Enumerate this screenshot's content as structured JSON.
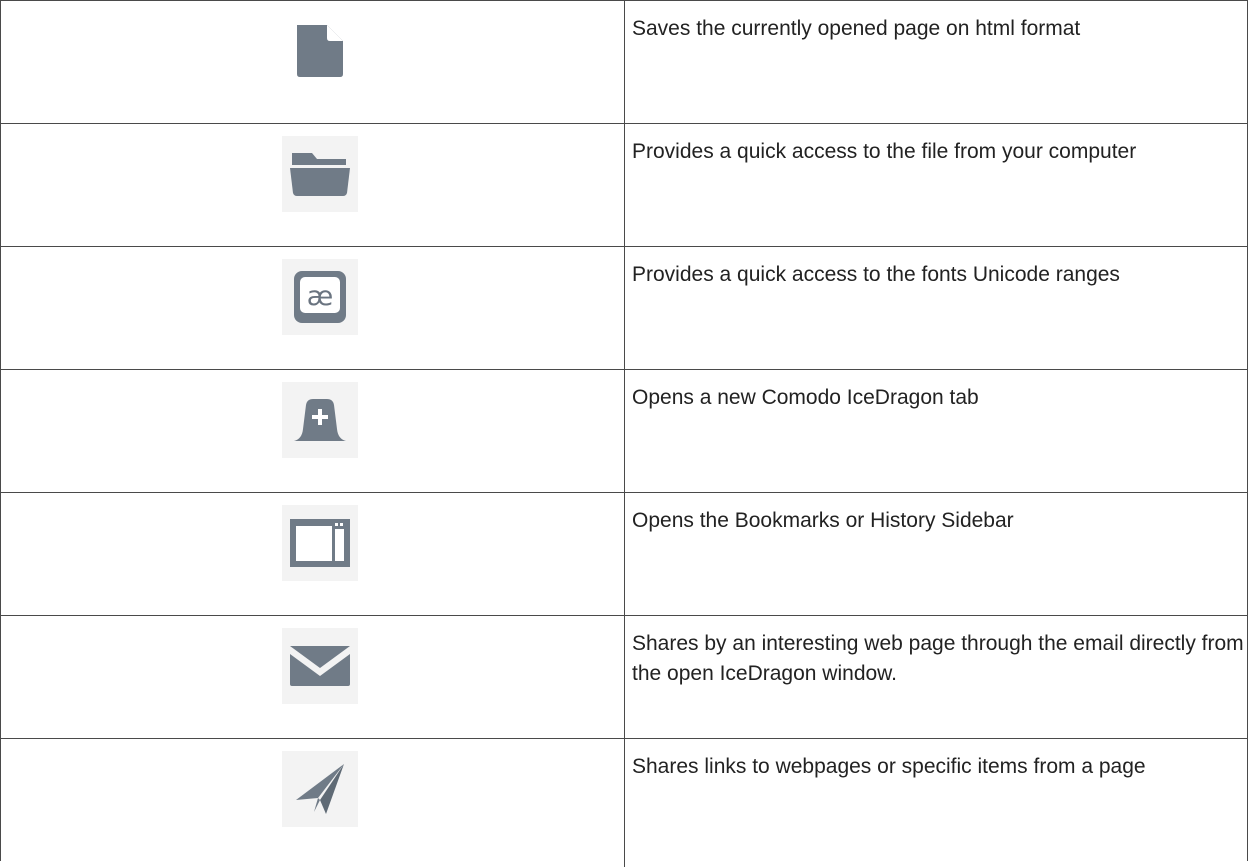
{
  "rows": [
    {
      "icon": "new-page-icon",
      "description": "Saves the currently opened page on html format"
    },
    {
      "icon": "open-folder-icon",
      "description": "Provides a quick access to the file from your computer"
    },
    {
      "icon": "character-encoding-icon",
      "description": "Provides a quick access to the fonts Unicode ranges"
    },
    {
      "icon": "new-tab-icon",
      "description": "Opens a new Comodo IceDragon tab"
    },
    {
      "icon": "sidebar-icon",
      "description": "Opens the Bookmarks or History Sidebar"
    },
    {
      "icon": "email-icon",
      "description": "Shares by an interesting web page through the email directly from the open IceDragon window."
    },
    {
      "icon": "share-plane-icon",
      "description": "Shares links to webpages or specific items from a page"
    }
  ],
  "colors": {
    "icon_fill": "#707b87",
    "border": "#4a4a4a",
    "icon_bg": "#f3f3f3"
  }
}
